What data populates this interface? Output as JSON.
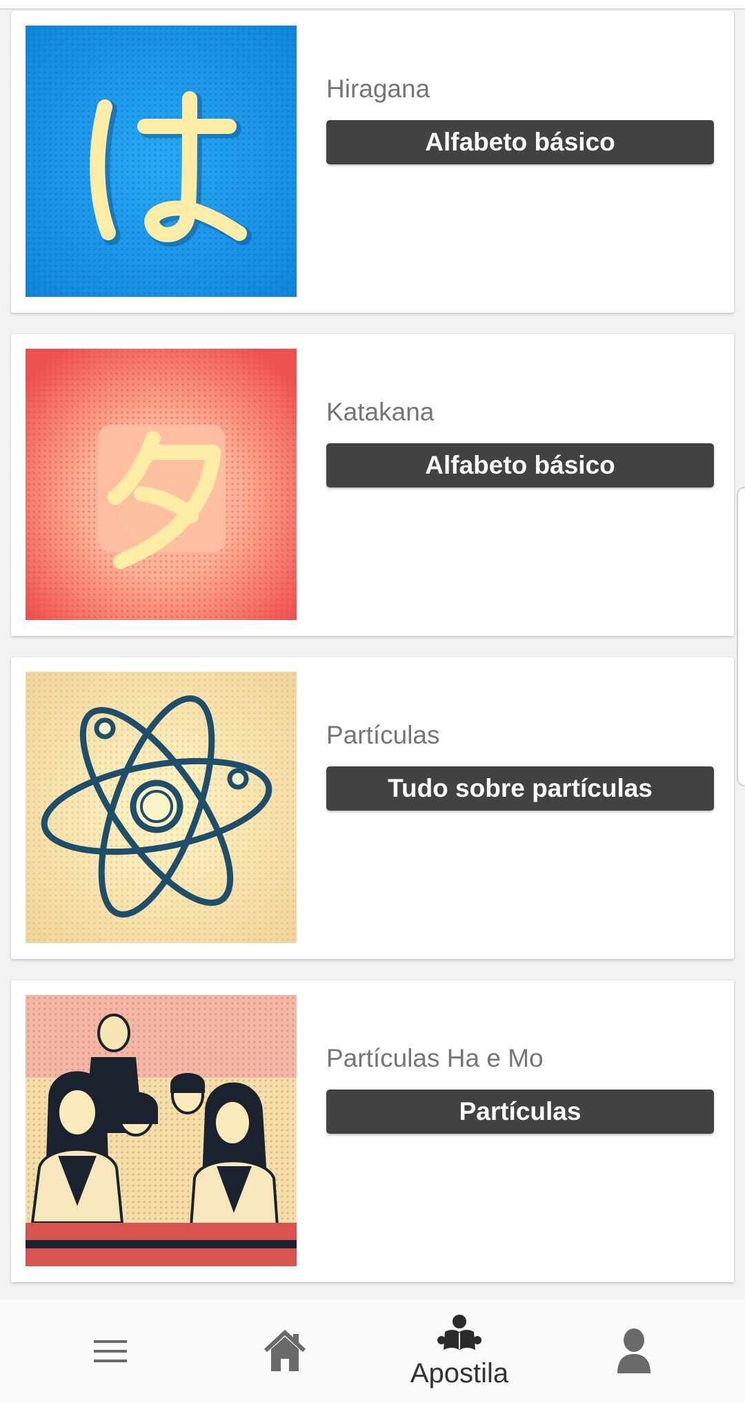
{
  "lessons": [
    {
      "title": "Hiragana",
      "tag": "Alfabeto básico",
      "image": "hiragana-ha-image"
    },
    {
      "title": "Katakana",
      "tag": "Alfabeto básico",
      "image": "katakana-ta-image"
    },
    {
      "title": "Partículas",
      "tag": "Tudo sobre partículas",
      "image": "atom-image"
    },
    {
      "title": "Partículas Ha e Mo",
      "tag": "Partículas",
      "image": "students-image"
    }
  ],
  "bottom_nav": {
    "menu_icon": "menu-icon",
    "home_icon": "home-icon",
    "apostila_icon": "reading-person-icon",
    "apostila_label": "Apostila",
    "profile_icon": "user-icon"
  },
  "colors": {
    "tag_background": "#424242",
    "hiragana_bg": "#1e9be8",
    "katakana_bg": "#f2605a",
    "atom_bg": "#f3dca3",
    "glyph_cream": "#fdeca6"
  }
}
